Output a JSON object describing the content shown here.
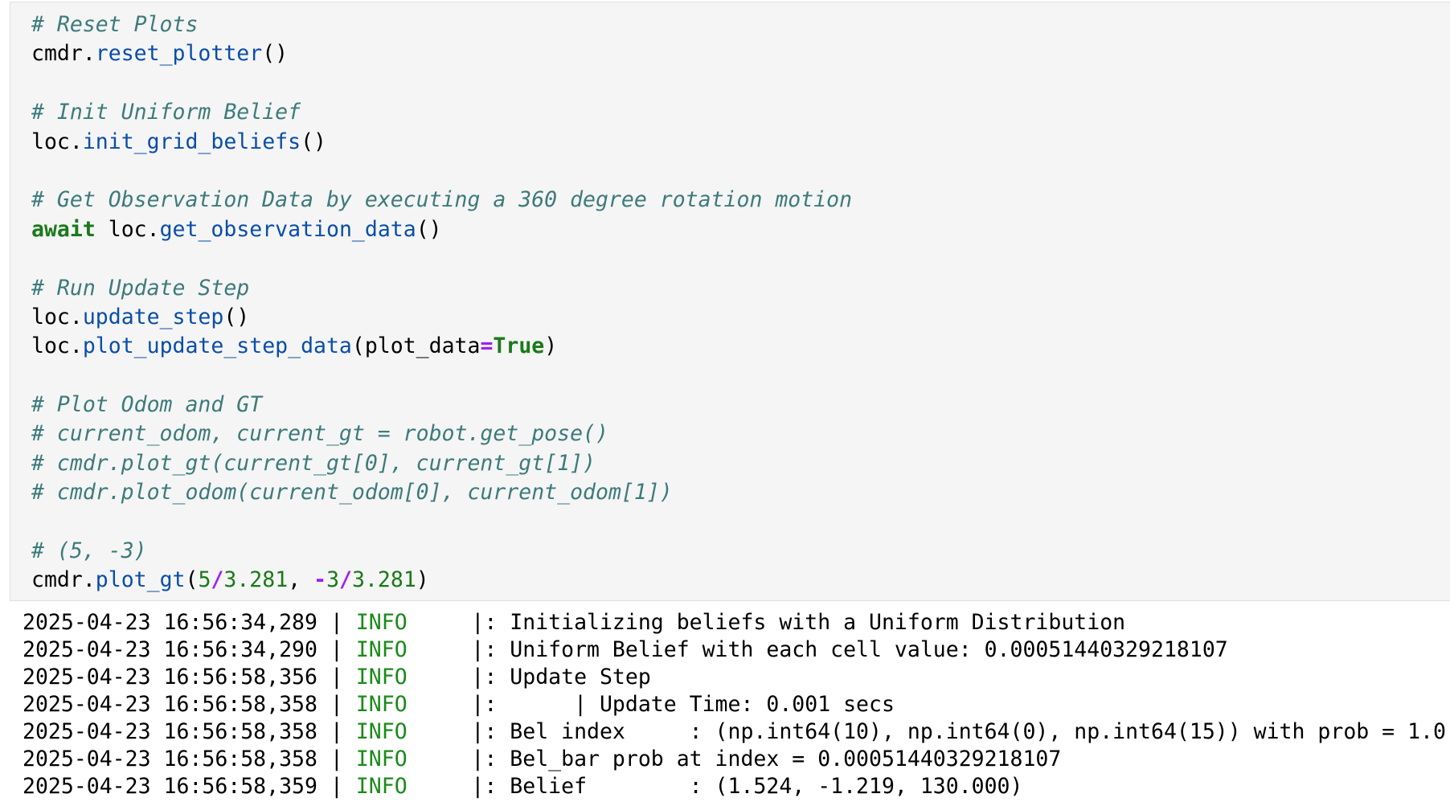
{
  "code_cell": {
    "lines": [
      {
        "comment": "# Reset Plots"
      },
      {
        "obj": "cmdr",
        "method": "reset_plotter",
        "args": "()"
      },
      {
        "blank": true
      },
      {
        "comment": "# Init Uniform Belief"
      },
      {
        "obj": "loc",
        "method": "init_grid_beliefs",
        "args": "()"
      },
      {
        "blank": true
      },
      {
        "comment": "# Get Observation Data by executing a 360 degree rotation motion"
      },
      {
        "keyword": "await",
        "obj": "loc",
        "method": "get_observation_data",
        "args": "()"
      },
      {
        "blank": true
      },
      {
        "comment": "# Run Update Step"
      },
      {
        "obj": "loc",
        "method": "update_step",
        "args": "()"
      },
      {
        "obj": "loc",
        "method": "plot_update_step_data",
        "args_open": "(plot_data",
        "op": "=",
        "value": "True",
        "args_close": ")"
      },
      {
        "blank": true
      },
      {
        "comment": "# Plot Odom and GT"
      },
      {
        "comment": "# current_odom, current_gt = robot.get_pose()"
      },
      {
        "comment": "# cmdr.plot_gt(current_gt[0], current_gt[1])"
      },
      {
        "comment": "# cmdr.plot_odom(current_odom[0], current_odom[1])"
      },
      {
        "blank": true
      },
      {
        "comment": "# (5, -3)"
      },
      {
        "obj": "cmdr",
        "method": "plot_gt",
        "tokens": [
          {
            "t": "(",
            "c": "p"
          },
          {
            "t": "5",
            "c": "n"
          },
          {
            "t": "/",
            "c": "o"
          },
          {
            "t": "3.281",
            "c": "n"
          },
          {
            "t": ", ",
            "c": "p"
          },
          {
            "t": "-",
            "c": "o"
          },
          {
            "t": "3",
            "c": "n"
          },
          {
            "t": "/",
            "c": "o"
          },
          {
            "t": "3.281",
            "c": "n"
          },
          {
            "t": ")",
            "c": "p"
          }
        ]
      }
    ]
  },
  "output_cell": {
    "logs": [
      {
        "ts": "2025-04-23 16:56:34,289",
        "sep": " | ",
        "level": "INFO",
        "msg": "     |: Initializing beliefs with a Uniform Distribution"
      },
      {
        "ts": "2025-04-23 16:56:34,290",
        "sep": " | ",
        "level": "INFO",
        "msg": "     |: Uniform Belief with each cell value: 0.00051440329218107"
      },
      {
        "ts": "2025-04-23 16:56:58,356",
        "sep": " | ",
        "level": "INFO",
        "msg": "     |: Update Step"
      },
      {
        "ts": "2025-04-23 16:56:58,358",
        "sep": " | ",
        "level": "INFO",
        "msg": "     |:      | Update Time: 0.001 secs"
      },
      {
        "ts": "2025-04-23 16:56:58,358",
        "sep": " | ",
        "level": "INFO",
        "msg": "     |: Bel index     : (np.int64(10), np.int64(0), np.int64(15)) with prob = 1.0"
      },
      {
        "ts": "2025-04-23 16:56:58,358",
        "sep": " | ",
        "level": "INFO",
        "msg": "     |: Bel_bar prob at index = 0.00051440329218107"
      },
      {
        "ts": "2025-04-23 16:56:58,359",
        "sep": " | ",
        "level": "INFO",
        "msg": "     |: Belief        : (1.524, -1.219, 130.000)"
      }
    ]
  }
}
